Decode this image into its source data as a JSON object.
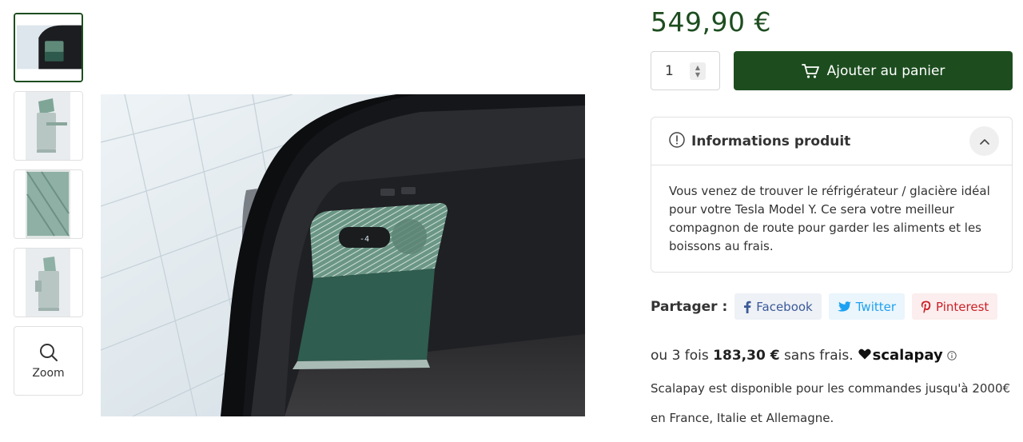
{
  "product": {
    "price": "549,90 €",
    "quantity": "1",
    "add_to_cart_label": "Ajouter au panier"
  },
  "gallery": {
    "zoom_label": "Zoom",
    "fridge_display": "-4"
  },
  "info": {
    "title": "Informations produit",
    "description": "Vous venez de trouver le réfrigérateur / glacière idéal pour votre Tesla Model Y. Ce sera votre meilleur compagnon de route pour garder les aliments et les boissons au frais."
  },
  "share": {
    "label": "Partager :",
    "facebook": "Facebook",
    "twitter": "Twitter",
    "pinterest": "Pinterest"
  },
  "scalapay": {
    "prefix": "ou 3 fois",
    "amount": "183,30 €",
    "suffix": "sans frais.",
    "brand": "scalapay",
    "note": "Scalapay est disponible pour les commandes jusqu'à 2000€ en France, Italie et Allemagne."
  },
  "colors": {
    "accent": "#1d4d1f",
    "facebook": "#3b5998",
    "twitter": "#1da1f2",
    "pinterest": "#cb2027"
  }
}
